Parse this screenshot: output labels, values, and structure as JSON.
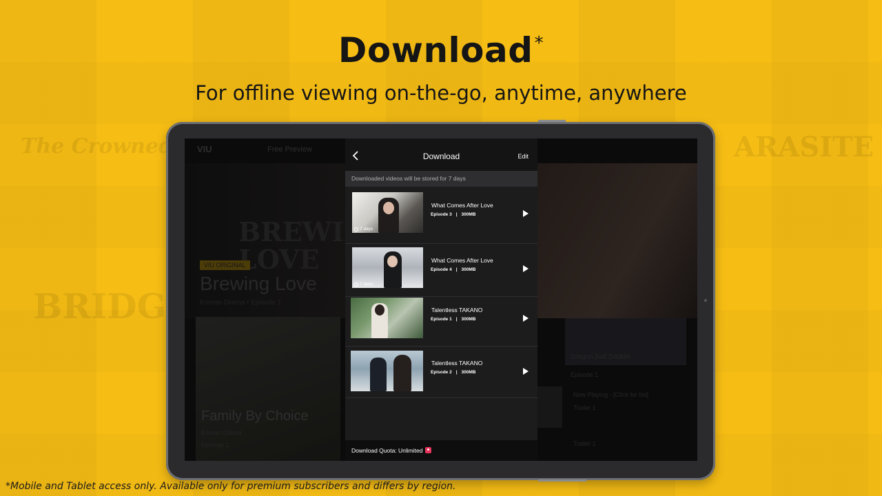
{
  "promo": {
    "headline": "Download",
    "headline_mark": "*",
    "subheadline": "For offline viewing on-the-go, anytime, anywhere",
    "footnote": "*Mobile and Tablet access only. Available only for premium subscribers and differs by region.",
    "bg_color": "#f6bd14"
  },
  "app_background": {
    "logo": "VIU",
    "top_tab": "Free Preview",
    "hero_title_line1": "BREWING",
    "hero_title_line2": "LOVE",
    "hero_badge": "VIU ORIGINAL",
    "hero_name": "Brewing Love",
    "hero_sub": "Korean Drama • Episode 1",
    "left_card_title": "Family By Choice",
    "left_card_meta1": "Korean Drama",
    "left_card_meta2": "Episode 1",
    "right_tile1_title": "Dragon Ball DAIMA",
    "right_tile1_meta": "Episode 1",
    "right_tile2_title": "Now Playing - [Click for list]",
    "right_tile2_meta": "Trailer 1",
    "right_tile3_title": "Trailer 1"
  },
  "download_panel": {
    "title": "Download",
    "edit_label": "Edit",
    "notice": "Downloaded videos will be stored for 7 days",
    "items": [
      {
        "title": "What Comes After Love",
        "episode": "Episode 3",
        "size": "300MB",
        "days": "7 days",
        "thumb_icon": "drama-still-woman"
      },
      {
        "title": "What Comes After Love",
        "episode": "Episode 4",
        "size": "300MB",
        "days": "7 days",
        "thumb_icon": "drama-still-man-snow"
      },
      {
        "title": "Talentless TAKANO",
        "episode": "Episode 1",
        "size": "300MB",
        "days": "",
        "thumb_icon": "drama-still-street"
      },
      {
        "title": "Talentless TAKANO",
        "episode": "Episode 2",
        "size": "300MB",
        "days": "",
        "thumb_icon": "drama-still-office"
      }
    ],
    "separator": "|",
    "quota_label": "Download Quota: Unlimited"
  }
}
